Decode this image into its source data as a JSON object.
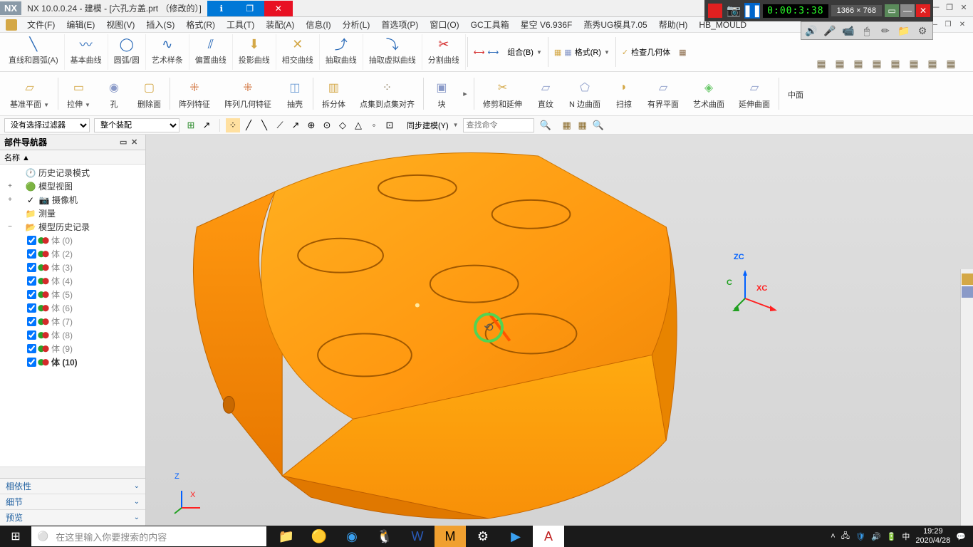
{
  "title": "NX 10.0.0.24 - 建模 - [六孔方盖.prt （修改的）]",
  "nx_logo": "NX",
  "menus": [
    "文件(F)",
    "编辑(E)",
    "视图(V)",
    "插入(S)",
    "格式(R)",
    "工具(T)",
    "装配(A)",
    "信息(I)",
    "分析(L)",
    "首选项(P)",
    "窗口(O)",
    "GC工具箱",
    "星空 V6.936F",
    "燕秀UG模具7.05",
    "帮助(H)",
    "HB_MOULD"
  ],
  "ribbon1": [
    {
      "label": "直线和圆弧(A)",
      "icon": "↘"
    },
    {
      "label": "基本曲线",
      "icon": "〰"
    },
    {
      "label": "圆弧/圆",
      "icon": "◯"
    },
    {
      "label": "艺术样条",
      "icon": "∿"
    },
    {
      "label": "偏置曲线",
      "icon": "⫽"
    },
    {
      "label": "投影曲线",
      "icon": "⬇"
    },
    {
      "label": "相交曲线",
      "icon": "✕"
    },
    {
      "label": "抽取曲线",
      "icon": "⤴"
    },
    {
      "label": "抽取虚拟曲线",
      "icon": "⤵"
    },
    {
      "label": "分割曲线",
      "icon": "✂"
    }
  ],
  "ribbon1_right": {
    "combo": "组合(B)",
    "format": "格式(R)",
    "check": "检查几何体"
  },
  "ribbon2": [
    {
      "label": "基准平面",
      "icon_color": "#d4a847"
    },
    {
      "label": "拉伸",
      "icon_color": "#d4a847"
    },
    {
      "label": "孔",
      "icon_color": "#8a9ac8"
    },
    {
      "label": "删除面",
      "icon_color": "#d4a847"
    },
    {
      "label": "阵列特征",
      "icon_color": "#d47a47"
    },
    {
      "label": "阵列几何特征",
      "icon_color": "#d47a47"
    },
    {
      "label": "抽壳",
      "icon_color": "#6a9ad4"
    },
    {
      "label": "拆分体",
      "icon_color": "#d4a847"
    },
    {
      "label": "点集到点集对齐",
      "icon_color": "#8a7a5a"
    },
    {
      "label": "块",
      "icon_color": "#8a9ac8"
    },
    {
      "label": "修剪和延伸",
      "icon_color": "#d4a847"
    },
    {
      "label": "直纹",
      "icon_color": "#8a9ac8"
    },
    {
      "label": "N 边曲面",
      "icon_color": "#8a9ac8"
    },
    {
      "label": "扫掠",
      "icon_color": "#d4a847"
    },
    {
      "label": "有界平面",
      "icon_color": "#8a9ac8"
    },
    {
      "label": "艺术曲面",
      "icon_color": "#6ac86a"
    },
    {
      "label": "延伸曲面",
      "icon_color": "#8a9ac8"
    },
    {
      "label": "中面",
      "icon_color": ""
    }
  ],
  "filter": {
    "combo1": "没有选择过滤器",
    "combo2": "整个装配",
    "sync_label": "同步建模(Y)",
    "search_placeholder": "查找命令"
  },
  "panel": {
    "title": "部件导航器",
    "col": "名称 ▲",
    "items": [
      {
        "indent": 0,
        "toggle": "",
        "check": false,
        "icon": "🕐",
        "label": "历史记录模式",
        "class": ""
      },
      {
        "indent": 0,
        "toggle": "+",
        "check": false,
        "icon": "🟢",
        "label": "模型视图",
        "class": ""
      },
      {
        "indent": 0,
        "toggle": "+",
        "check": false,
        "icon": "✓",
        "icon2": "📷",
        "label": "摄像机",
        "class": ""
      },
      {
        "indent": 0,
        "toggle": "",
        "check": false,
        "icon": "📁",
        "label": "测量",
        "class": ""
      },
      {
        "indent": 0,
        "toggle": "−",
        "check": false,
        "icon": "📂",
        "label": "模型历史记录",
        "class": ""
      },
      {
        "indent": 1,
        "toggle": "",
        "check": true,
        "icon": "🔶",
        "label": "体 (0)",
        "class": "gray"
      },
      {
        "indent": 1,
        "toggle": "",
        "check": true,
        "icon": "🔶",
        "label": "体 (2)",
        "class": "gray"
      },
      {
        "indent": 1,
        "toggle": "",
        "check": true,
        "icon": "🔶",
        "label": "体 (3)",
        "class": "gray"
      },
      {
        "indent": 1,
        "toggle": "",
        "check": true,
        "icon": "🔶",
        "label": "体 (4)",
        "class": "gray"
      },
      {
        "indent": 1,
        "toggle": "",
        "check": true,
        "icon": "🔶",
        "label": "体 (5)",
        "class": "gray"
      },
      {
        "indent": 1,
        "toggle": "",
        "check": true,
        "icon": "🔶",
        "label": "体 (6)",
        "class": "gray"
      },
      {
        "indent": 1,
        "toggle": "",
        "check": true,
        "icon": "🔶",
        "label": "体 (7)",
        "class": "gray"
      },
      {
        "indent": 1,
        "toggle": "",
        "check": true,
        "icon": "🔶",
        "label": "体 (8)",
        "class": "gray"
      },
      {
        "indent": 1,
        "toggle": "",
        "check": true,
        "icon": "🔶",
        "label": "体 (9)",
        "class": "gray"
      },
      {
        "indent": 1,
        "toggle": "",
        "check": true,
        "icon": "🔶",
        "label": "体 (10)",
        "class": "bold"
      }
    ],
    "sub": [
      "相依性",
      "细节",
      "预览"
    ]
  },
  "axes": {
    "zc": "ZC",
    "xc": "XC",
    "yc": "C",
    "z": "Z",
    "x": "X"
  },
  "recorder": {
    "timer": "0:00:3:38",
    "dimensions": "1366 × 768"
  },
  "taskbar": {
    "search": "在这里输入你要搜索的内容",
    "time": "19:29",
    "date": "2020/4/28"
  }
}
